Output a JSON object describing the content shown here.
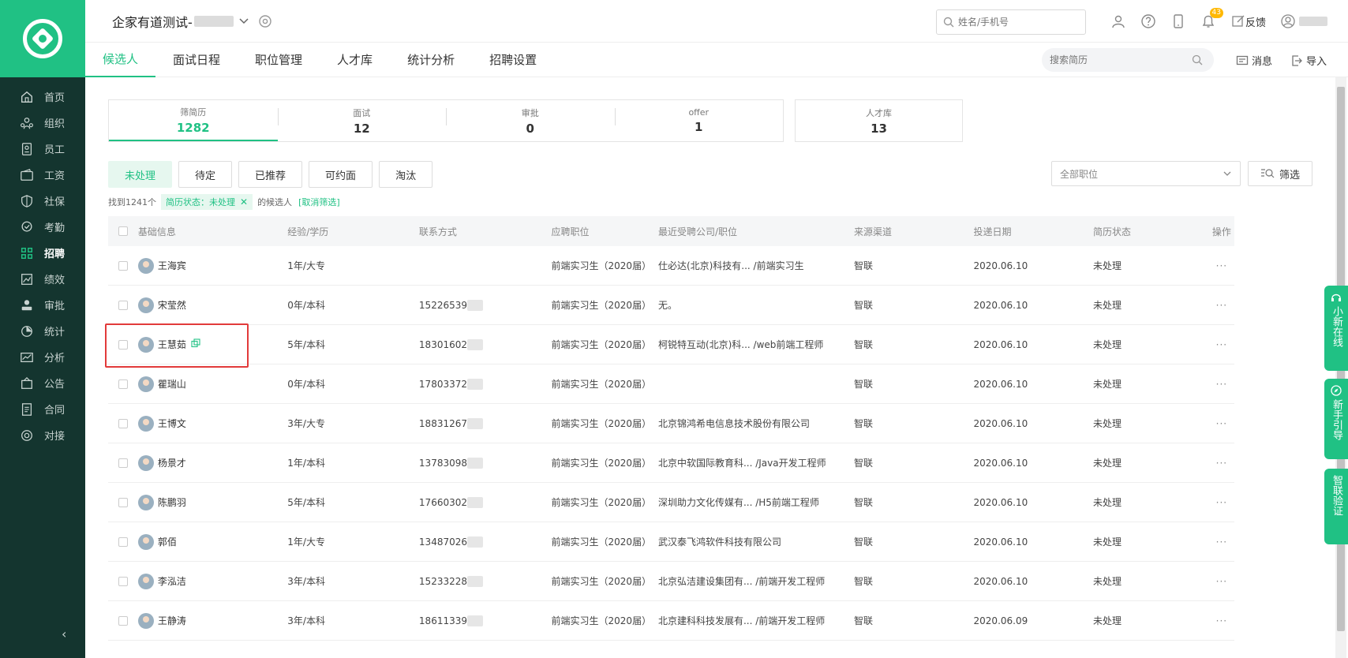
{
  "header": {
    "company": "企家有道测试-",
    "search_placeholder": "姓名/手机号",
    "notification_count": "43",
    "feedback": "反馈"
  },
  "sidebar": {
    "items": [
      {
        "label": "首页",
        "icon": "home-icon"
      },
      {
        "label": "组织",
        "icon": "org-icon"
      },
      {
        "label": "员工",
        "icon": "employee-icon"
      },
      {
        "label": "工资",
        "icon": "wallet-icon"
      },
      {
        "label": "社保",
        "icon": "shield-icon"
      },
      {
        "label": "考勤",
        "icon": "location-icon"
      },
      {
        "label": "招聘",
        "icon": "recruit-icon"
      },
      {
        "label": "绩效",
        "icon": "performance-icon"
      },
      {
        "label": "审批",
        "icon": "approve-icon"
      },
      {
        "label": "统计",
        "icon": "pie-icon"
      },
      {
        "label": "分析",
        "icon": "analysis-icon"
      },
      {
        "label": "公告",
        "icon": "notice-icon"
      },
      {
        "label": "合同",
        "icon": "contract-icon"
      },
      {
        "label": "对接",
        "icon": "connect-icon"
      }
    ],
    "active": "招聘"
  },
  "tabs": [
    "候选人",
    "面试日程",
    "职位管理",
    "人才库",
    "统计分析",
    "招聘设置"
  ],
  "tabbar": {
    "resume_search_placeholder": "搜索简历",
    "messages": "消息",
    "import": "导入"
  },
  "stats": [
    {
      "label": "筛简历",
      "value": "1282"
    },
    {
      "label": "面试",
      "value": "12"
    },
    {
      "label": "审批",
      "value": "0"
    },
    {
      "label": "offer",
      "value": "1"
    }
  ],
  "talent": {
    "label": "人才库",
    "value": "13"
  },
  "filters": [
    "未处理",
    "待定",
    "已推荐",
    "可约面",
    "淘汰"
  ],
  "position_select": "全部职位",
  "screen_button": "筛选",
  "result": {
    "found": "找到1241个",
    "tag": "简历状态：未处理",
    "suffix": "的候选人",
    "cancel": "[取消筛选]"
  },
  "table": {
    "headers": [
      "基础信息",
      "经验/学历",
      "联系方式",
      "应聘职位",
      "最近受聘公司/职位",
      "来源渠道",
      "投递日期",
      "简历状态",
      "操作"
    ],
    "rows": [
      {
        "name": "王海宾",
        "exp": "1年/大专",
        "phone": "",
        "job": "前端实习生（2020届）",
        "company": "仕必达(北京)科技有... /前端实习生",
        "source": "智联",
        "date": "2020.06.10",
        "status": "未处理"
      },
      {
        "name": "宋莹然",
        "exp": "0年/本科",
        "phone": "15226539",
        "job": "前端实习生（2020届）",
        "company": "无。",
        "source": "智联",
        "date": "2020.06.10",
        "status": "未处理"
      },
      {
        "name": "王慧茹",
        "exp": "5年/本科",
        "phone": "18301602",
        "job": "前端实习生（2020届）",
        "company": "柯锐特互动(北京)科... /web前端工程师",
        "source": "智联",
        "date": "2020.06.10",
        "status": "未处理"
      },
      {
        "name": "瞿瑞山",
        "exp": "0年/本科",
        "phone": "17803372",
        "job": "前端实习生（2020届）",
        "company": "",
        "source": "智联",
        "date": "2020.06.10",
        "status": "未处理"
      },
      {
        "name": "王博文",
        "exp": "3年/大专",
        "phone": "18831267",
        "job": "前端实习生（2020届）",
        "company": "北京锦鸿希电信息技术股份有限公司",
        "source": "智联",
        "date": "2020.06.10",
        "status": "未处理"
      },
      {
        "name": "杨景才",
        "exp": "1年/本科",
        "phone": "13783098",
        "job": "前端实习生（2020届）",
        "company": "北京中软国际教育科... /Java开发工程师",
        "source": "智联",
        "date": "2020.06.10",
        "status": "未处理"
      },
      {
        "name": "陈鹏羽",
        "exp": "5年/本科",
        "phone": "17660302",
        "job": "前端实习生（2020届）",
        "company": "深圳助力文化传媒有... /H5前端工程师",
        "source": "智联",
        "date": "2020.06.10",
        "status": "未处理"
      },
      {
        "name": "郭佰",
        "exp": "1年/大专",
        "phone": "13487026",
        "job": "前端实习生（2020届）",
        "company": "武汉泰飞鸿软件科技有限公司",
        "source": "智联",
        "date": "2020.06.10",
        "status": "未处理"
      },
      {
        "name": "李泓洁",
        "exp": "3年/本科",
        "phone": "15233228",
        "job": "前端实习生（2020届）",
        "company": "北京弘洁建设集团有... /前端开发工程师",
        "source": "智联",
        "date": "2020.06.10",
        "status": "未处理"
      },
      {
        "name": "王静涛",
        "exp": "3年/本科",
        "phone": "18611339",
        "job": "前端实习生（2020届）",
        "company": "北京建科科技发展有... /前端开发工程师",
        "source": "智联",
        "date": "2020.06.09",
        "status": "未处理"
      }
    ],
    "more": "···"
  },
  "float_buttons": [
    "小新在线",
    "新手引导",
    "智联验证"
  ],
  "colors": {
    "accent": "#20c184",
    "sidebar": "#14352f",
    "highlight": "#e23a3a"
  }
}
